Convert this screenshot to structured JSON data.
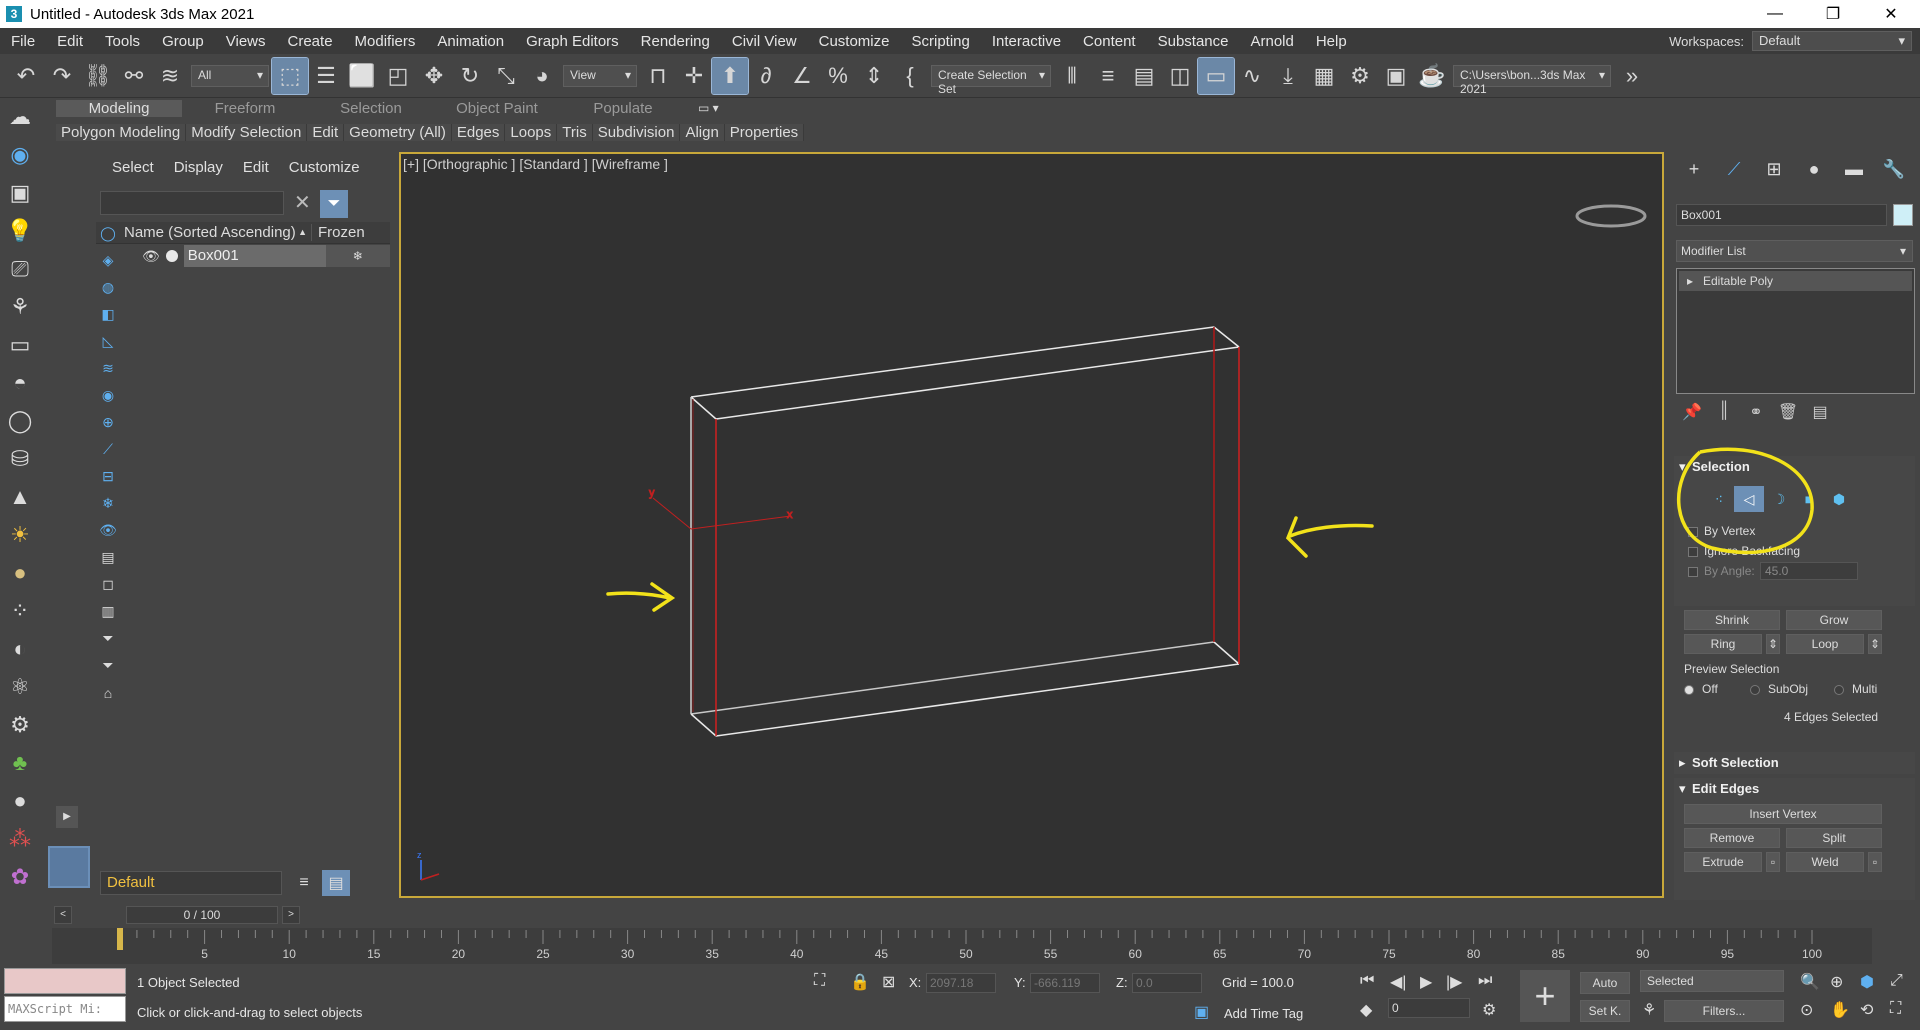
{
  "window": {
    "title": "Untitled - Autodesk 3ds Max 2021",
    "app_icon": "3",
    "minimize": "—",
    "maximize": "❐",
    "close": "✕"
  },
  "menu": [
    "File",
    "Edit",
    "Tools",
    "Group",
    "Views",
    "Create",
    "Modifiers",
    "Animation",
    "Graph Editors",
    "Rendering",
    "Civil View",
    "Customize",
    "Scripting",
    "Interactive",
    "Content",
    "Substance",
    "Arnold",
    "Help"
  ],
  "workspace": {
    "label": "Workspaces:",
    "value": "Default"
  },
  "toolbar": {
    "filter": "All",
    "ref_coord": "View",
    "selection_set": "Create Selection Set",
    "project_path": "C:\\Users\\bon...3ds Max 2021"
  },
  "ribbon": {
    "tabs": [
      "Modeling",
      "Freeform",
      "Selection",
      "Object Paint",
      "Populate"
    ],
    "commands": [
      "Polygon Modeling",
      "Modify Selection",
      "Edit",
      "Geometry (All)",
      "Edges",
      "Loops",
      "Tris",
      "Subdivision",
      "Align",
      "Properties"
    ]
  },
  "explorer": {
    "tabs": [
      "Select",
      "Display",
      "Edit",
      "Customize"
    ],
    "col_name": "Name (Sorted Ascending)",
    "col_frozen": "Frozen",
    "rows": [
      {
        "name": "Box001"
      }
    ],
    "layer": "Default"
  },
  "viewport": {
    "label": "[+] [Orthographic ] [Standard ] [Wireframe ]",
    "active_border_color": "#c8a83a"
  },
  "command_panel": {
    "object_name": "Box001",
    "modifier_list": "Modifier List",
    "stack_item": "Editable Poly",
    "selection": {
      "title": "Selection",
      "by_vertex": "By Vertex",
      "ignore_backfacing": "Ignore Backfacing",
      "by_angle": "By Angle:",
      "angle_value": "45.0",
      "shrink": "Shrink",
      "grow": "Grow",
      "ring": "Ring",
      "loop": "Loop",
      "preview_title": "Preview Selection",
      "preview_off": "Off",
      "preview_subobj": "SubObj",
      "preview_multi": "Multi",
      "status": "4 Edges Selected"
    },
    "soft_selection": "Soft Selection",
    "edit_edges": {
      "title": "Edit Edges",
      "insert_vertex": "Insert Vertex",
      "remove": "Remove",
      "split": "Split",
      "extrude": "Extrude",
      "weld": "Weld"
    }
  },
  "timeline": {
    "frame": "0 / 100",
    "ticks": [
      "5",
      "10",
      "15",
      "20",
      "25",
      "30",
      "35",
      "40",
      "45",
      "50",
      "55",
      "60",
      "65",
      "70",
      "75",
      "80",
      "85",
      "90",
      "95",
      "100"
    ]
  },
  "status": {
    "maxscript": "MAXScript Mi:",
    "selected": "1 Object Selected",
    "prompt": "Click or click-and-drag to select objects",
    "x_label": "X:",
    "x_value": "2097.18",
    "y_label": "Y:",
    "y_value": "-666.119",
    "z_label": "Z:",
    "z_value": "0.0",
    "grid": "Grid = 100.0",
    "add_time_tag": "Add Time Tag",
    "auto": "Auto",
    "selected_dropdown": "Selected",
    "set_key": "Set K.",
    "filters": "Filters...",
    "current_frame": "0"
  },
  "annotation_color": "#f2e21a"
}
